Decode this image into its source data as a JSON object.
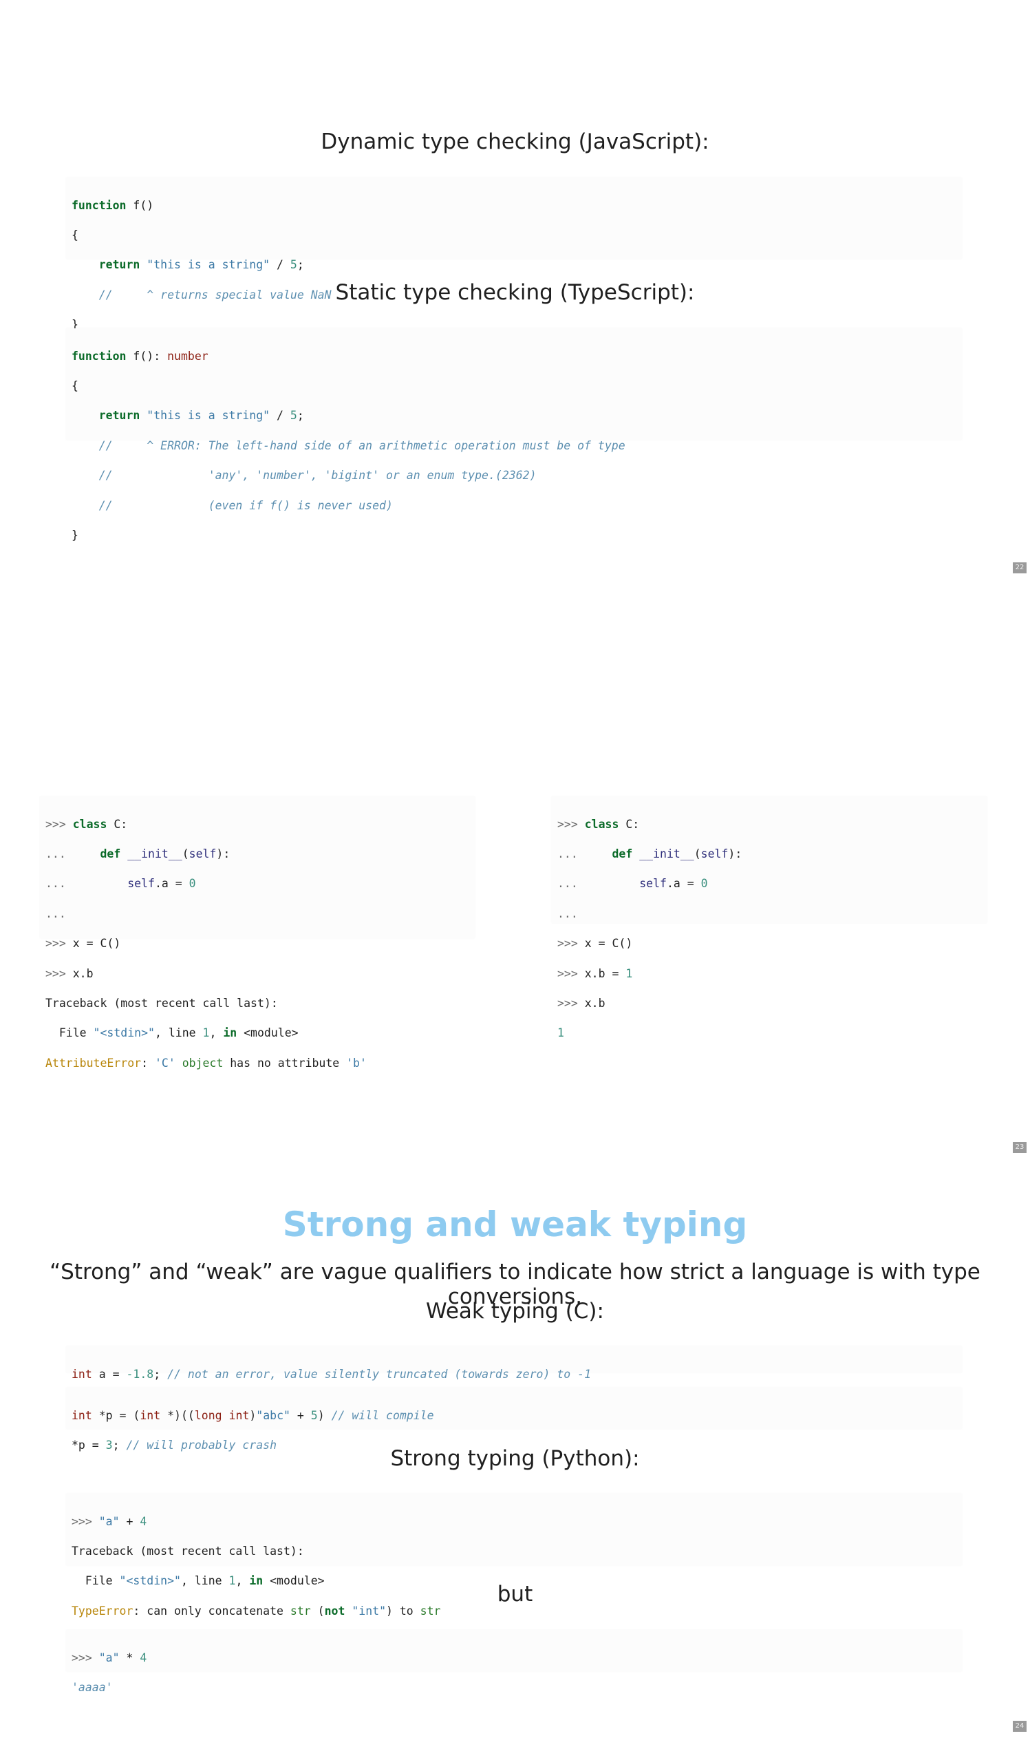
{
  "slide22": {
    "heading_js": "Dynamic type checking (JavaScript):",
    "heading_ts": "Static type checking (TypeScript):",
    "page_number": "22"
  },
  "slide23": {
    "page_number": "23"
  },
  "slide24": {
    "title": "Strong and weak typing",
    "intro": "“Strong” and “weak” are vague qualifiers to indicate how strict a language is with type conversions.",
    "heading_weak": "Weak typing (C):",
    "heading_strong": "Strong typing (Python):",
    "but": "but",
    "page_number": "24"
  },
  "colors": {
    "keyword": "#0b6b29",
    "string": "#3d7aa6",
    "comment": "#5c8fb0",
    "type": "#8b1e12",
    "title": "#8ecbf0",
    "error": "#b8860b"
  }
}
